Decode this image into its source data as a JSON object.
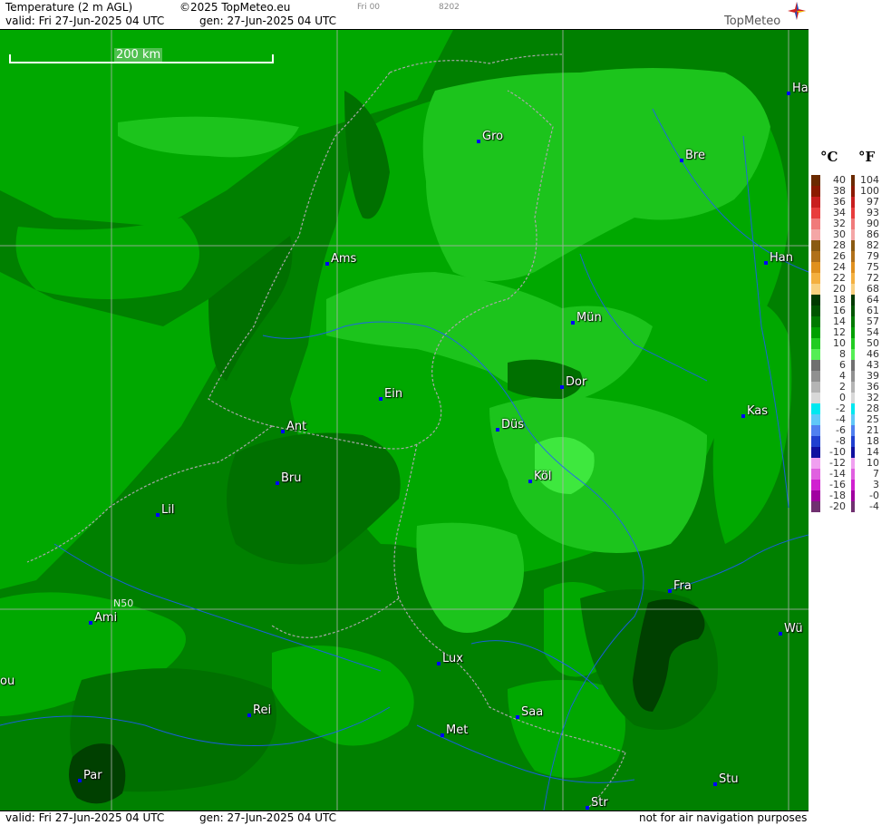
{
  "header": {
    "title": "Temperature (2 m AGL)",
    "copyright": "©2025 TopMeteo.eu",
    "run_label": "Fri 00",
    "code": "8202",
    "valid": "valid:  Fri  27-Jun-2025  04 UTC",
    "gen": "gen:  27-Jun-2025 04 UTC",
    "brand": "TopMeteo"
  },
  "footer": {
    "valid": "valid:  Fri  27-Jun-2025  04 UTC",
    "gen": "gen:  27-Jun-2025 04 UTC",
    "disclaimer": "not for air navigation purposes"
  },
  "map": {
    "scale_label": "200 km",
    "graticule_label": "N50",
    "cities": [
      {
        "label": "Ha"
      },
      {
        "label": "Gro"
      },
      {
        "label": "Bre"
      },
      {
        "label": "Ams"
      },
      {
        "label": "Han"
      },
      {
        "label": "Mün"
      },
      {
        "label": "Ein"
      },
      {
        "label": "Dor"
      },
      {
        "label": "Kas"
      },
      {
        "label": "Ant"
      },
      {
        "label": "Düs"
      },
      {
        "label": "Bru"
      },
      {
        "label": "Köl"
      },
      {
        "label": "Lil"
      },
      {
        "label": "Fra"
      },
      {
        "label": "Ami"
      },
      {
        "label": "Wü"
      },
      {
        "label": "Lux"
      },
      {
        "label": "ou"
      },
      {
        "label": "Rei"
      },
      {
        "label": "Saa"
      },
      {
        "label": "Met"
      },
      {
        "label": "Par"
      },
      {
        "label": "Stu"
      },
      {
        "label": "Str"
      }
    ]
  },
  "legend": {
    "celsius_header": "°C",
    "fahrenheit_header": "°F",
    "rows": [
      {
        "c": "40",
        "f": "104",
        "color": "#6b2a00"
      },
      {
        "c": "38",
        "f": "100",
        "color": "#8b1a00"
      },
      {
        "c": "36",
        "f": "97",
        "color": "#c81e1e"
      },
      {
        "c": "34",
        "f": "93",
        "color": "#e83c3c"
      },
      {
        "c": "32",
        "f": "90",
        "color": "#f07a7a"
      },
      {
        "c": "30",
        "f": "86",
        "color": "#f4a6a6"
      },
      {
        "c": "28",
        "f": "82",
        "color": "#8a5a12"
      },
      {
        "c": "26",
        "f": "79",
        "color": "#b0701a"
      },
      {
        "c": "24",
        "f": "75",
        "color": "#e0901e"
      },
      {
        "c": "22",
        "f": "72",
        "color": "#f4b040"
      },
      {
        "c": "20",
        "f": "68",
        "color": "#f8d080"
      },
      {
        "c": "18",
        "f": "64",
        "color": "#003a00"
      },
      {
        "c": "16",
        "f": "61",
        "color": "#005500"
      },
      {
        "c": "14",
        "f": "57",
        "color": "#007a00"
      },
      {
        "c": "12",
        "f": "54",
        "color": "#00a000"
      },
      {
        "c": "10",
        "f": "50",
        "color": "#22cc22"
      },
      {
        "c": "8",
        "f": "46",
        "color": "#55ee55"
      },
      {
        "c": "6",
        "f": "43",
        "color": "#707070"
      },
      {
        "c": "4",
        "f": "39",
        "color": "#909090"
      },
      {
        "c": "2",
        "f": "36",
        "color": "#b4b4b4"
      },
      {
        "c": "0",
        "f": "32",
        "color": "#d8d8d8"
      },
      {
        "c": "-2",
        "f": "28",
        "color": "#00e8f0"
      },
      {
        "c": "-4",
        "f": "25",
        "color": "#60c8f8"
      },
      {
        "c": "-6",
        "f": "21",
        "color": "#5080f0"
      },
      {
        "c": "-8",
        "f": "18",
        "color": "#2040d0"
      },
      {
        "c": "-10",
        "f": "14",
        "color": "#1010a0"
      },
      {
        "c": "-12",
        "f": "10",
        "color": "#f0a0f0"
      },
      {
        "c": "-14",
        "f": "7",
        "color": "#e060e0"
      },
      {
        "c": "-16",
        "f": "3",
        "color": "#d020d0"
      },
      {
        "c": "-18",
        "f": "-0",
        "color": "#a000a0"
      },
      {
        "c": "-20",
        "f": "-4",
        "color": "#703070"
      }
    ]
  },
  "colors": {
    "t16": "#008000",
    "t18": "#005c00",
    "t14": "#00a800",
    "t12": "#1cc41c",
    "t10": "#3ee83e",
    "city_marker": "#0000ff",
    "rivers": "#1e5aff",
    "borders": "#9a9a9a"
  }
}
